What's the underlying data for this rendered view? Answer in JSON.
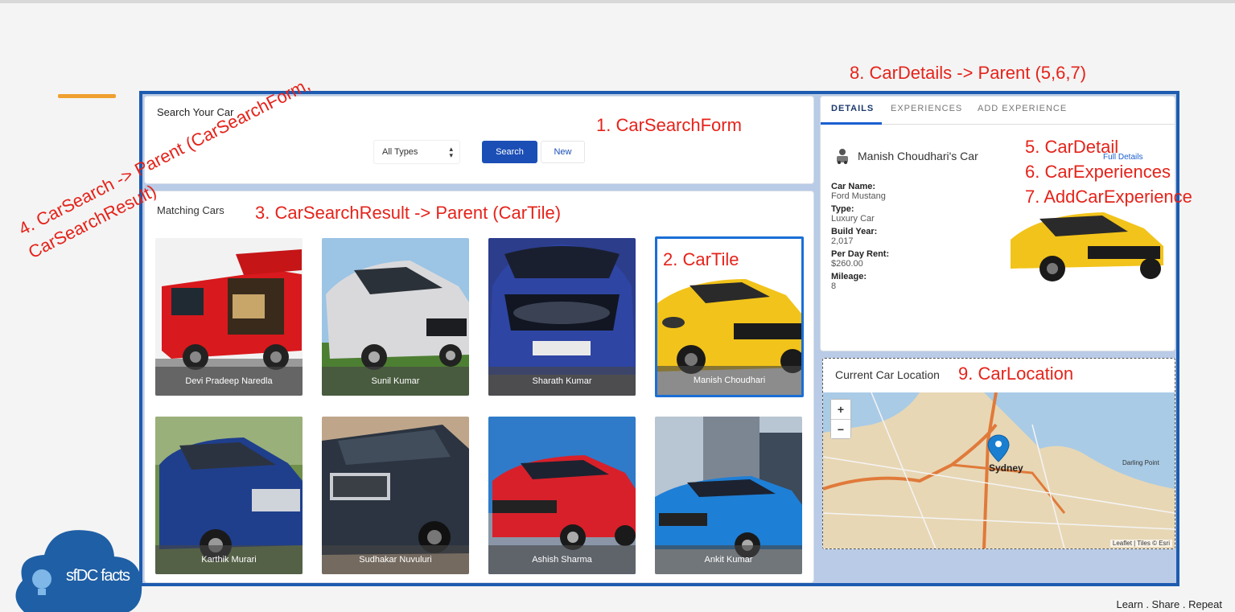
{
  "search_form": {
    "title": "Search Your Car",
    "type_select_value": "All Types",
    "search_label": "Search",
    "new_label": "New"
  },
  "results": {
    "title": "Matching Cars",
    "tiles": [
      {
        "owner": "Devi Pradeep Naredla"
      },
      {
        "owner": "Sunil Kumar"
      },
      {
        "owner": "Sharath Kumar"
      },
      {
        "owner": "Manish Choudhari"
      },
      {
        "owner": "Karthik Murari"
      },
      {
        "owner": "Sudhakar Nuvuluri"
      },
      {
        "owner": "Ashish Sharma"
      },
      {
        "owner": "Ankit Kumar"
      }
    ]
  },
  "details": {
    "tabs": [
      "DETAILS",
      "EXPERIENCES",
      "ADD EXPERIENCE"
    ],
    "owner_title": "Manish Choudhari's Car",
    "full_details": "Full Details",
    "fields": [
      {
        "label": "Car Name:",
        "value": "Ford Mustang"
      },
      {
        "label": "Type:",
        "value": "Luxury Car"
      },
      {
        "label": "Build Year:",
        "value": "2,017"
      },
      {
        "label": "Per Day Rent:",
        "value": "$260.00"
      },
      {
        "label": "Mileage:",
        "value": "8"
      }
    ]
  },
  "location": {
    "title": "Current Car Location",
    "zoom_in": "+",
    "zoom_out": "−",
    "city_label": "Sydney",
    "place_label": "Darling Point",
    "attribution": "Leaflet | Tiles © Esri"
  },
  "annotations": {
    "a1": "1. CarSearchForm",
    "a2": "2. CarTile",
    "a3": "3. CarSearchResult -> Parent (CarTile)",
    "a4_line1": "4. CarSearch -> Parent (CarSearchForm,",
    "a4_line2": "CarSearchResult)",
    "a5": "5. CarDetail",
    "a6": "6. CarExperiences",
    "a7": "7. AddCarExperience",
    "a8": "8. CarDetails -> Parent (5,6,7)",
    "a9": "9. CarLocation"
  },
  "logo_text": "sfDC facts",
  "footer": "Learn . Share . Repeat",
  "colors": {
    "accent": "#1b4fb6",
    "annotation": "#e5231a",
    "frame_border": "#1d5bb0",
    "orange_bar": "#f0a030"
  }
}
